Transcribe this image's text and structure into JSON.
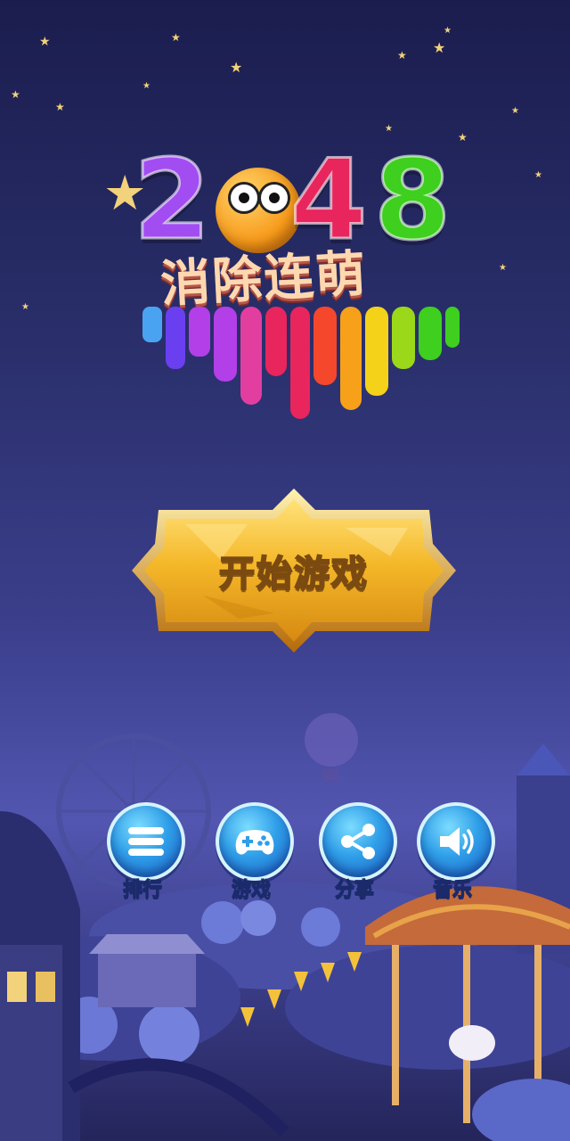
{
  "logo": {
    "digits": [
      "2",
      "4",
      "8"
    ],
    "title": "消除连萌"
  },
  "start_button": {
    "label": "开始游戏"
  },
  "menu": [
    {
      "id": "rank",
      "label": "排行",
      "icon": "list-icon"
    },
    {
      "id": "games",
      "label": "游戏",
      "icon": "gamepad-icon"
    },
    {
      "id": "share",
      "label": "分享",
      "icon": "share-icon"
    },
    {
      "id": "music",
      "label": "音乐",
      "icon": "speaker-icon"
    }
  ],
  "colors": {
    "digit_2": "#a24df2",
    "digit_4": "#e8255c",
    "digit_8": "#3ecf1f",
    "button_gold": "#f2b62a",
    "menu_blue": "#2f9ee8"
  }
}
